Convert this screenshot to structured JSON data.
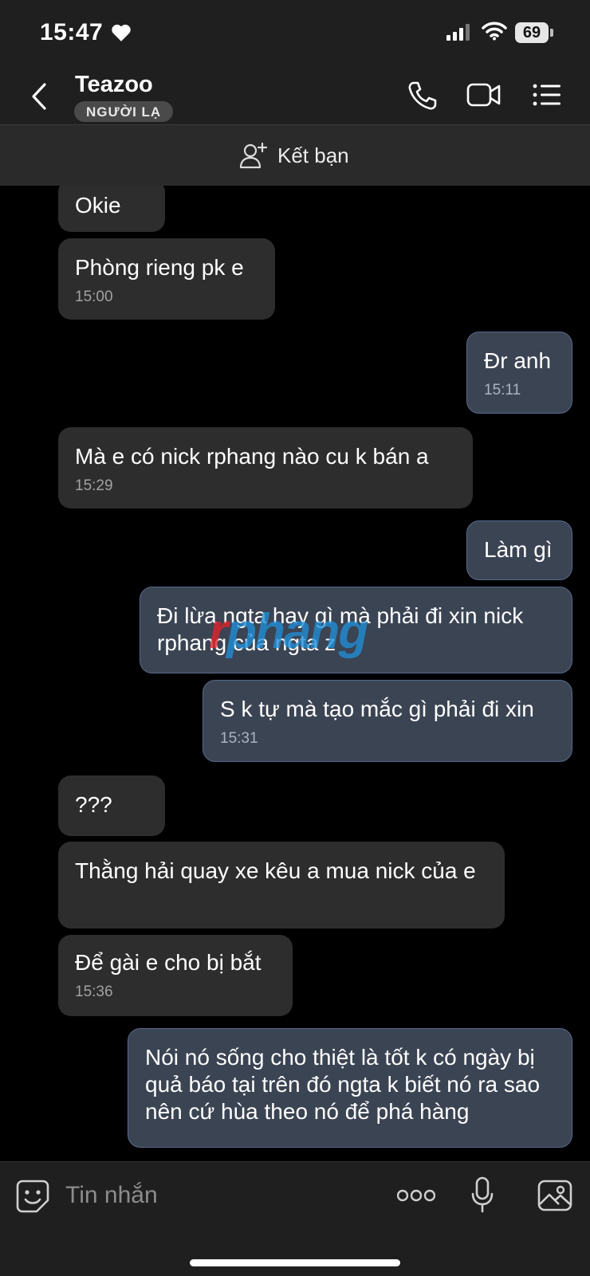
{
  "status_bar": {
    "time": "15:47",
    "battery": "69"
  },
  "header": {
    "contact_name": "Teazoo",
    "badge": "NGƯỜI LẠ"
  },
  "friend_bar": {
    "label": "Kết bạn"
  },
  "messages": [
    {
      "dir": "in",
      "text": "Okie",
      "time": ""
    },
    {
      "dir": "in",
      "text": "Phòng rieng pk e",
      "time": "15:00"
    },
    {
      "dir": "out",
      "text": "Đr anh",
      "time": "15:11"
    },
    {
      "dir": "in",
      "text": "Mà e có nick rphang nào cu k bán a",
      "time": "15:29"
    },
    {
      "dir": "out",
      "text": "Làm gì",
      "time": ""
    },
    {
      "dir": "out",
      "text": "Đi lừa ngta hay gì mà phải đi xin nick rphang của ngta z",
      "time": ""
    },
    {
      "dir": "out",
      "text": "S k tự mà tạo mắc gì phải đi xin",
      "time": "15:31"
    },
    {
      "dir": "in",
      "text": "???",
      "time": ""
    },
    {
      "dir": "in",
      "text": "Thằng hải quay xe kêu a mua nick của e",
      "time": ""
    },
    {
      "dir": "in",
      "text": "Để gài e cho bị bắt",
      "time": "15:36"
    },
    {
      "dir": "out",
      "text": "Nói nó sống cho thiệt là tốt k có ngày bị quả báo tại trên đó ngta k biết nó ra sao nên cứ hùa theo nó để phá hàng",
      "time": ""
    }
  ],
  "watermark": {
    "first": "r",
    "rest": "phang"
  },
  "composer": {
    "placeholder": "Tin nhắn"
  },
  "icons": [
    "heart-icon",
    "signal-icon",
    "wifi-icon",
    "back-icon",
    "phone-icon",
    "video-icon",
    "menu-icon",
    "add-friend-icon",
    "sticker-icon",
    "more-icon",
    "mic-icon",
    "image-icon"
  ],
  "colors": {
    "incoming_bubble": "#2d2d2d",
    "outgoing_bubble": "#3b4453",
    "outgoing_border": "#55698c",
    "header_bg": "#1f1f1f"
  }
}
